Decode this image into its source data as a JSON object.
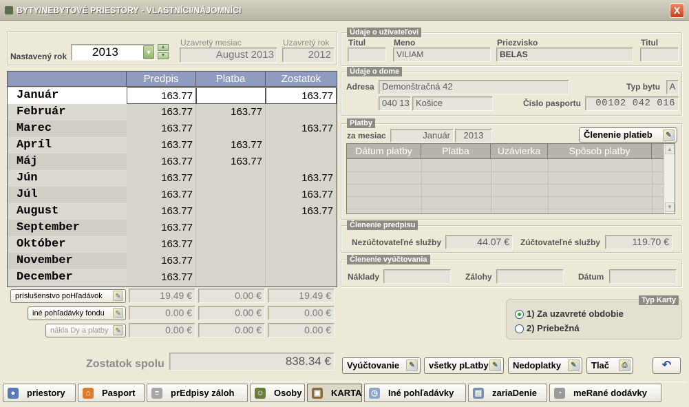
{
  "window": {
    "title": "BYTY/NEBYTOVÉ PRIESTORY - VLASTNÍCI/NÁJOMNÍCI",
    "close_label": "X"
  },
  "year_section": {
    "label_set_year": "Nastavený rok",
    "year_value": "2013",
    "label_closed_month": "Uzavretý mesiac",
    "closed_month_value": "August 2013",
    "label_closed_year": "Uzavretý rok",
    "closed_year_value": "2012"
  },
  "user": {
    "group_title": "Údaje o užívateľovi",
    "label_title": "Titul",
    "label_first_name": "Meno",
    "label_last_name": "Priezvisko",
    "label_title2": "Titul",
    "title_value": "",
    "first_name": "VILIAM",
    "last_name": "BELAS",
    "title2_value": ""
  },
  "house": {
    "group_title": "Údaje o dome",
    "label_address": "Adresa",
    "address": "Demonštračná 42",
    "label_unit_type": "Typ bytu",
    "unit_type": "A",
    "zip": "040 13",
    "city": "Košice",
    "label_passport": "Číslo pasportu",
    "passport_number": "00102 042 016"
  },
  "payments": {
    "group_title": "Platby",
    "label_for_month": "za mesiac",
    "month": "Január",
    "year": "2013",
    "breakdown_button": "Členenie platieb",
    "columns": [
      "Dátum platby",
      "Platba",
      "Uzávierka",
      "Spôsob platby"
    ]
  },
  "prescription_breakdown": {
    "group_title": "Členenie predpisu",
    "label_non_billable": "Nezúčtovateľné služby",
    "non_billable_value": "44.07 €",
    "label_billable": "Zúčtovateľné služby",
    "billable_value": "119.70 €"
  },
  "billing_breakdown": {
    "group_title": "Členenie vyúčtovania",
    "label_costs": "Náklady",
    "label_advances": "Zálohy",
    "label_date": "Dátum"
  },
  "card_type": {
    "group_title": "Typ Karty",
    "option1": "1) Za uzavreté obdobie",
    "option2": "2) Priebežná",
    "selected": 1
  },
  "grid": {
    "columns": [
      "Predpis",
      "Platba",
      "Zostatok"
    ],
    "rows": [
      {
        "month": "Január",
        "predpis": "163.77",
        "platba": "",
        "zostatok": "163.77"
      },
      {
        "month": "Február",
        "predpis": "163.77",
        "platba": "163.77",
        "zostatok": ""
      },
      {
        "month": "Marec",
        "predpis": "163.77",
        "platba": "",
        "zostatok": "163.77"
      },
      {
        "month": "Apríl",
        "predpis": "163.77",
        "platba": "163.77",
        "zostatok": ""
      },
      {
        "month": "Máj",
        "predpis": "163.77",
        "platba": "163.77",
        "zostatok": ""
      },
      {
        "month": "Jún",
        "predpis": "163.77",
        "platba": "",
        "zostatok": "163.77"
      },
      {
        "month": "Júl",
        "predpis": "163.77",
        "platba": "",
        "zostatok": "163.77"
      },
      {
        "month": "August",
        "predpis": "163.77",
        "platba": "",
        "zostatok": "163.77"
      },
      {
        "month": "September",
        "predpis": "163.77",
        "platba": "",
        "zostatok": ""
      },
      {
        "month": "Október",
        "predpis": "163.77",
        "platba": "",
        "zostatok": ""
      },
      {
        "month": "November",
        "predpis": "163.77",
        "platba": "",
        "zostatok": ""
      },
      {
        "month": "December",
        "predpis": "163.77",
        "platba": "",
        "zostatok": ""
      }
    ]
  },
  "extras": [
    {
      "label": "príslušenstvo poHľadávok",
      "predpis": "19.49 €",
      "platba": "0.00 €",
      "zostatok": "19.49 €"
    },
    {
      "label": "iné pohľadávky fondu",
      "predpis": "0.00 €",
      "platba": "0.00 €",
      "zostatok": "0.00 €"
    },
    {
      "label": "nákla Dy a platby",
      "predpis": "0.00 €",
      "platba": "0.00 €",
      "zostatok": "0.00 €"
    }
  ],
  "total": {
    "label": "Zostatok spolu",
    "value": "838.34 €"
  },
  "actions": {
    "billing": "Vyúčtovanie",
    "all_payments": "všetky pLatby",
    "arrears": "Nedoplatky",
    "print": "Tlač"
  },
  "tabs": [
    {
      "label": "priestory"
    },
    {
      "label": "Pasport"
    },
    {
      "label": "prEdpisy záloh"
    },
    {
      "label": "Osoby"
    },
    {
      "label": "KARTA"
    },
    {
      "label": "Iné pohľadávky"
    },
    {
      "label": "zariaDenie"
    },
    {
      "label": "meRané dodávky"
    }
  ]
}
